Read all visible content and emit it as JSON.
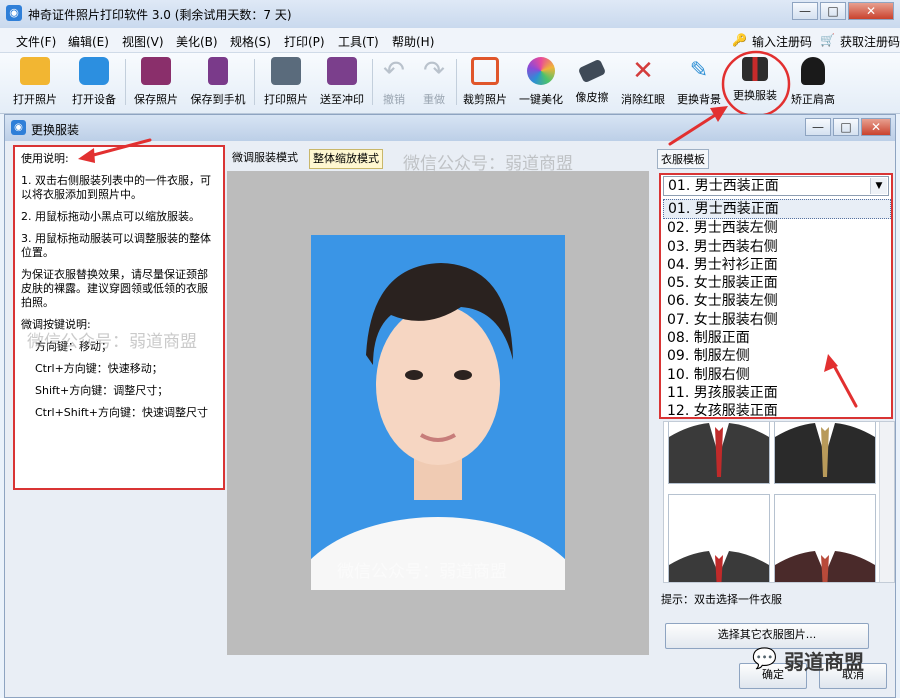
{
  "app": {
    "title": "神奇证件照片打印软件 3.0 (剩余试用天数：7 天)",
    "window_buttons": [
      "—",
      "□",
      "✕"
    ]
  },
  "menu": {
    "items": [
      "文件(F)",
      "编辑(E)",
      "视图(V)",
      "美化(B)",
      "规格(S)",
      "打印(P)",
      "工具(T)",
      "帮助(H)"
    ],
    "register": "输入注册码",
    "buy": "获取注册码"
  },
  "toolbar": {
    "tools": [
      {
        "label": "打开照片",
        "icon": "folder-open-icon",
        "color": "#f2b632"
      },
      {
        "label": "打开设备",
        "icon": "camera-icon",
        "color": "#2c8fe0"
      },
      {
        "label": "保存照片",
        "icon": "save-disk-icon",
        "color": "#8a2f6b"
      },
      {
        "label": "保存到手机",
        "icon": "phone-save-icon",
        "color": "#7a3a8a"
      },
      {
        "label": "打印照片",
        "icon": "printer-icon",
        "color": "#5a6b7c"
      },
      {
        "label": "送至冲印",
        "icon": "print-shop-icon",
        "color": "#7b3f8c"
      },
      {
        "label": "撤销",
        "icon": "undo-icon",
        "color": "#b9c2cc",
        "disabled": true
      },
      {
        "label": "重做",
        "icon": "redo-icon",
        "color": "#b9c2cc",
        "disabled": true
      },
      {
        "label": "裁剪照片",
        "icon": "crop-icon",
        "color": "#e0562b"
      },
      {
        "label": "一键美化",
        "icon": "color-wheel-icon",
        "color": "#e84a9a"
      },
      {
        "label": "像皮擦",
        "icon": "eraser-icon",
        "color": "#3f4a57"
      },
      {
        "label": "消除红眼",
        "icon": "remove-redeye-icon",
        "color": "#d33c3c"
      },
      {
        "label": "更换背景",
        "icon": "paint-brush-icon",
        "color": "#2d8fd5"
      },
      {
        "label": "更换服装",
        "icon": "suit-icon",
        "color": "#2d2d2d"
      },
      {
        "label": "矫正肩高",
        "icon": "shoulder-icon",
        "color": "#1a1a1a"
      }
    ]
  },
  "dialog": {
    "title": "更换服装",
    "instructions": {
      "heading": "使用说明:",
      "step1": "1. 双击右侧服装列表中的一件衣服，可以将衣服添加到照片中。",
      "step2": "2. 用鼠标拖动小黑点可以缩放服装。",
      "step3": "3. 用鼠标拖动服装可以调整服装的整体位置。",
      "note": "为保证衣服替换效果，请尽量保证颈部皮肤的裸露。建议穿圆领或低领的衣服拍照。",
      "keys_heading": "微调按键说明:",
      "key1": "方向键：移动；",
      "key2": "Ctrl+方向键：快速移动；",
      "key3": "Shift+方向键：调整尺寸；",
      "key4": "Ctrl+Shift+方向键：快速调整尺寸"
    },
    "modes": {
      "fine_tune": "微调服装模式",
      "zoom": "整体缩放模式"
    },
    "template_label": "衣服模板",
    "selected": "01. 男士西装正面",
    "options": [
      "01. 男士西装正面",
      "02. 男士西装左侧",
      "03. 男士西装右侧",
      "04. 男士衬衫正面",
      "05. 女士服装正面",
      "06. 女士服装左侧",
      "07. 女士服装右侧",
      "08. 制服正面",
      "09. 制服左侧",
      "10. 制服右侧",
      "11. 男孩服装正面",
      "12. 女孩服装正面"
    ],
    "hint": "提示：双击选择一件衣服",
    "choose_other": "选择其它衣服图片...",
    "ok": "确定",
    "cancel": "取消"
  },
  "watermark": {
    "text": "微信公众号：弱道商盟",
    "logo_text": "弱道商盟"
  },
  "colors": {
    "highlight": "#d93434",
    "photo_bg": "#3a95e6"
  }
}
